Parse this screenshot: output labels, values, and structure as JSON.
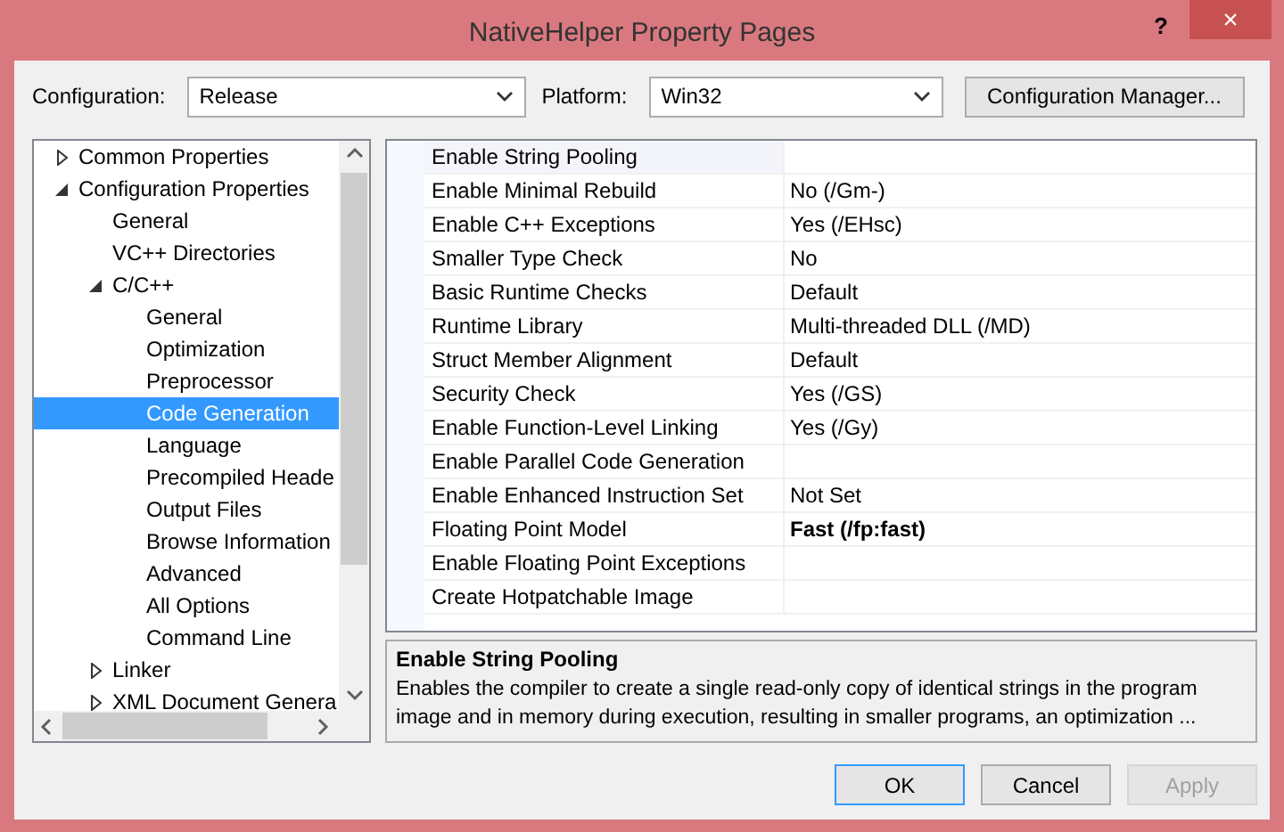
{
  "window": {
    "title": "NativeHelper Property Pages",
    "help_button": "?",
    "close_button": "×"
  },
  "toolbar": {
    "configuration_label": "Configuration:",
    "configuration_value": "Release",
    "platform_label": "Platform:",
    "platform_value": "Win32",
    "manager_button": "Configuration Manager..."
  },
  "tree": {
    "items": [
      {
        "label": "Common Properties",
        "expanded": false,
        "selected": false
      },
      {
        "label": "Configuration Properties",
        "expanded": true,
        "selected": false,
        "children": [
          {
            "label": "General",
            "selected": false
          },
          {
            "label": "VC++ Directories",
            "selected": false
          },
          {
            "label": "C/C++",
            "expanded": true,
            "selected": false,
            "children": [
              {
                "label": "General",
                "selected": false
              },
              {
                "label": "Optimization",
                "selected": false
              },
              {
                "label": "Preprocessor",
                "selected": false
              },
              {
                "label": "Code Generation",
                "selected": true
              },
              {
                "label": "Language",
                "selected": false
              },
              {
                "label": "Precompiled Heade",
                "selected": false
              },
              {
                "label": "Output Files",
                "selected": false
              },
              {
                "label": "Browse Information",
                "selected": false
              },
              {
                "label": "Advanced",
                "selected": false
              },
              {
                "label": "All Options",
                "selected": false
              },
              {
                "label": "Command Line",
                "selected": false
              }
            ]
          },
          {
            "label": "Linker",
            "expanded": false,
            "selected": false
          },
          {
            "label": "XML Document Genera",
            "expanded": false,
            "selected": false
          }
        ]
      }
    ]
  },
  "properties": [
    {
      "name": "Enable String Pooling",
      "selected": true
    },
    {
      "name": "Enable Minimal Rebuild",
      "value": "No (/Gm-)",
      "selected": false,
      "modified": false
    },
    {
      "name": "Enable C++ Exceptions",
      "value": "Yes (/EHsc)",
      "selected": false,
      "modified": false
    },
    {
      "name": "Smaller Type Check",
      "value": "No",
      "selected": false,
      "modified": false
    },
    {
      "name": "Basic Runtime Checks",
      "value": "Default",
      "selected": false,
      "modified": false
    },
    {
      "name": "Runtime Library",
      "value": "Multi-threaded DLL (/MD)",
      "selected": false,
      "modified": false
    },
    {
      "name": "Struct Member Alignment",
      "value": "Default",
      "selected": false,
      "modified": false
    },
    {
      "name": "Security Check",
      "value": "Yes (/GS)",
      "selected": false,
      "modified": false
    },
    {
      "name": "Enable Function-Level Linking",
      "value": "Yes (/Gy)",
      "selected": false,
      "modified": false
    },
    {
      "name": "Enable Parallel Code Generation",
      "selected": false
    },
    {
      "name": "Enable Enhanced Instruction Set",
      "value": "Not Set",
      "selected": false,
      "modified": false
    },
    {
      "name": "Floating Point Model",
      "value": "Fast (/fp:fast)",
      "selected": false,
      "modified": true
    },
    {
      "name": "Enable Floating Point Exceptions",
      "selected": false
    },
    {
      "name": "Create Hotpatchable Image",
      "selected": false
    }
  ],
  "description": {
    "title": "Enable String Pooling",
    "text": "Enables the compiler to create a single read-only copy of identical strings in the program image and in memory during execution, resulting in smaller programs, an optimization ..."
  },
  "buttons": [
    {
      "label": "OK",
      "default": true,
      "disabled": false
    },
    {
      "label": "Cancel",
      "default": false,
      "disabled": false
    },
    {
      "label": "Apply",
      "default": false,
      "disabled": true
    }
  ]
}
